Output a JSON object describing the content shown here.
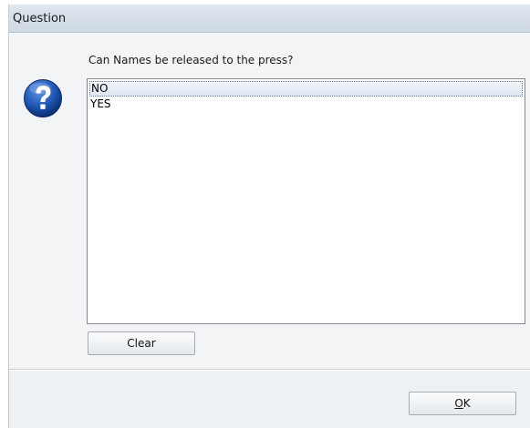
{
  "window": {
    "title": "Question"
  },
  "dialog": {
    "prompt": "Can Names be released to the press?",
    "icon": "question-icon",
    "options": [
      {
        "label": "NO",
        "selected": true
      },
      {
        "label": "YES",
        "selected": false
      }
    ],
    "clear_label": "Clear",
    "ok_label_mnemonic": "O",
    "ok_label_rest": "K"
  },
  "colors": {
    "icon_blue": "#1f57b3",
    "dialog_bg": "#f2f4f6",
    "titlebar": "#d7e0ea"
  }
}
